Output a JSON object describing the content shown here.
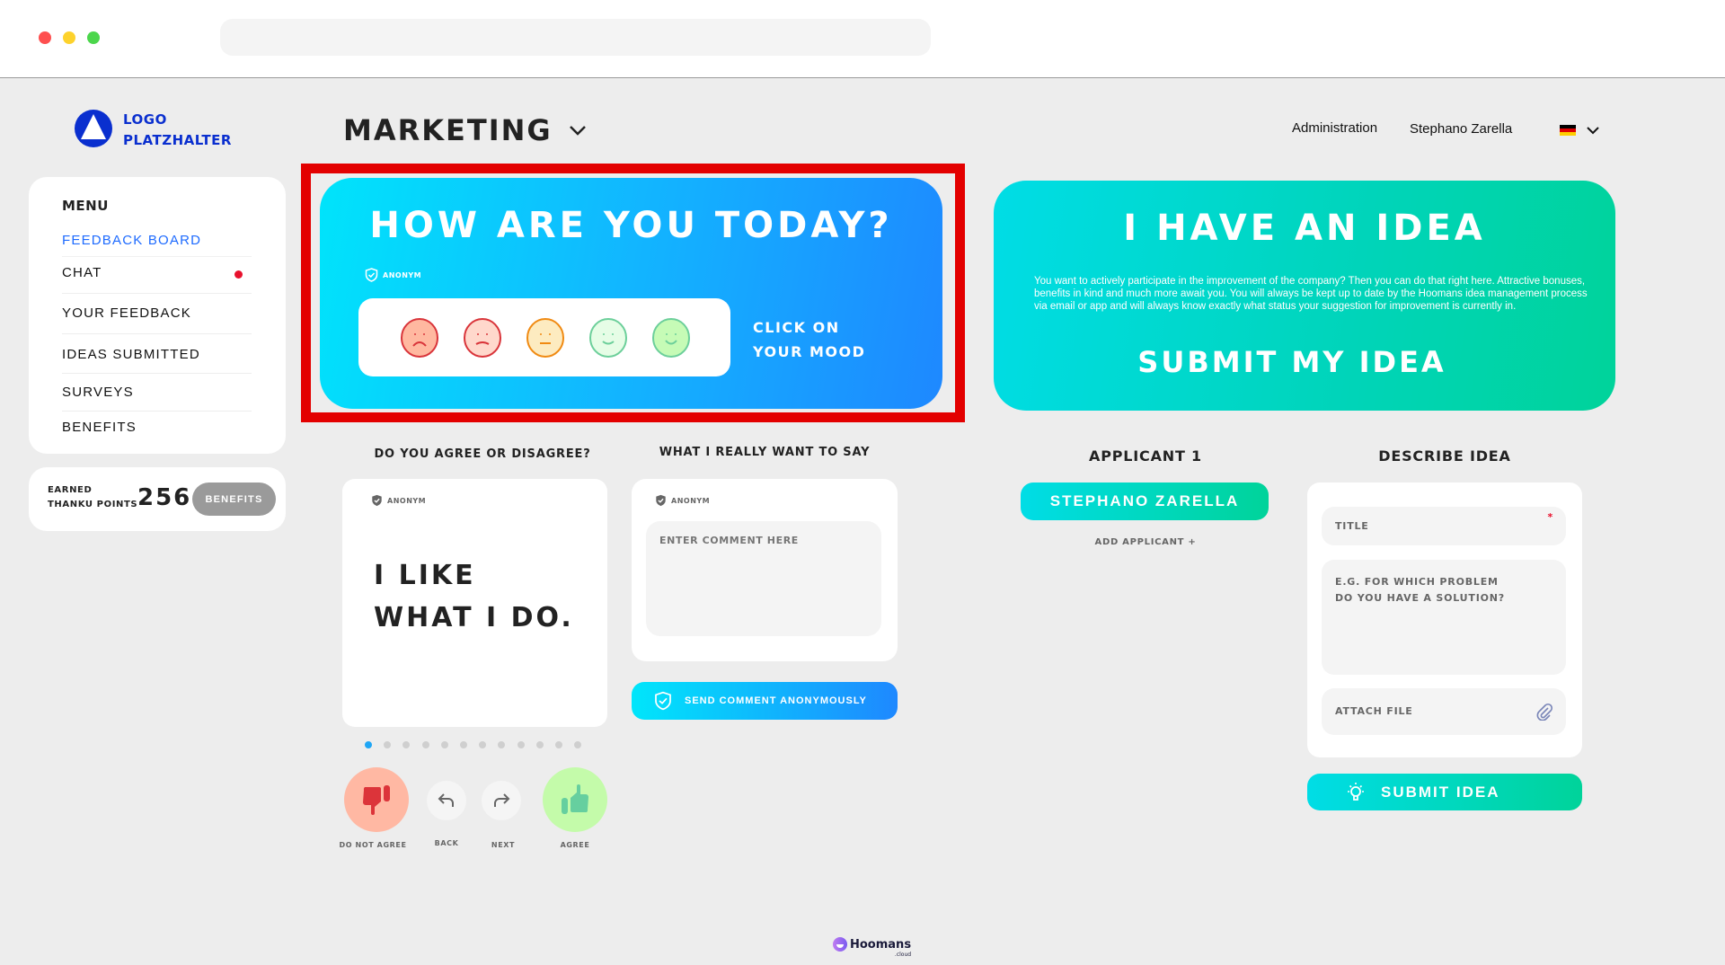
{
  "browser": {
    "address": ""
  },
  "logo": {
    "line1": "LOGO",
    "line2": "PLATZHALTER",
    "color": "#0a2fcf"
  },
  "header": {
    "department": "MARKETING",
    "admin_link": "Administration",
    "user_name": "Stephano Zarella",
    "language_flag": "de-flag-icon"
  },
  "menu": {
    "title": "MENU",
    "items": [
      {
        "label": "FEEDBACK BOARD",
        "active": true
      },
      {
        "label": "CHAT",
        "badge": true
      },
      {
        "label": "YOUR FEEDBACK"
      },
      {
        "label": "IDEAS SUBMITTED"
      },
      {
        "label": "SURVEYS"
      },
      {
        "label": "BENEFITS"
      }
    ]
  },
  "points": {
    "label_line1": "EARNED",
    "label_line2": "THANKU POINTS",
    "value": "256",
    "button": "BENEFITS"
  },
  "mood": {
    "title": "HOW ARE YOU TODAY?",
    "anonym": "ANONYM",
    "cta_line1": "CLICK ON",
    "cta_line2": "YOUR MOOD",
    "faces": [
      {
        "name": "very-sad",
        "fill": "#ffb8a0",
        "stroke": "#d9343a"
      },
      {
        "name": "sad",
        "fill": "#ffd8cc",
        "stroke": "#d9343a"
      },
      {
        "name": "neutral",
        "fill": "#fdebc0",
        "stroke": "#f08a12"
      },
      {
        "name": "happy",
        "fill": "#e6fde6",
        "stroke": "#6ccf9a"
      },
      {
        "name": "very-happy",
        "fill": "#c6fbb6",
        "stroke": "#6ccf9a"
      }
    ]
  },
  "idea": {
    "title": "I HAVE AN IDEA",
    "description": "You want to actively participate in the improvement of the company? Then you can do that right here. Attractive bonuses, benefits in kind and much more await you. You will always be kept up to date by the Hoomans idea management process via email or app and will always know exactly what status your suggestion for improvement is currently in.",
    "cta": "SUBMIT MY IDEA"
  },
  "agree": {
    "heading": "DO YOU AGREE OR DISAGREE?",
    "anonym": "ANONYM",
    "statement_line1": "I LIKE",
    "statement_line2": "WHAT I DO.",
    "pages_total": 12,
    "page_current": 1,
    "disagree_label": "DO NOT AGREE",
    "back_label": "BACK",
    "next_label": "NEXT",
    "agree_label": "AGREE"
  },
  "comment": {
    "heading": "WHAT I REALLY WANT TO SAY",
    "anonym": "ANONYM",
    "placeholder": "ENTER COMMENT HERE",
    "send_label": "SEND COMMENT ANONYMOUSLY"
  },
  "applicant": {
    "heading": "APPLICANT 1",
    "name": "STEPHANO ZARELLA",
    "add_label": "ADD APPLICANT +"
  },
  "describe": {
    "heading": "DESCRIBE IDEA",
    "title_placeholder": "TITLE",
    "description_placeholder_line1": "E.G. FOR WHICH PROBLEM",
    "description_placeholder_line2": "DO YOU HAVE A SOLUTION?",
    "attach_label": "ATTACH FILE",
    "submit_label": "SUBMIT IDEA"
  },
  "footer": {
    "brand": "Hoomans",
    "brand_sub": ".cloud"
  }
}
